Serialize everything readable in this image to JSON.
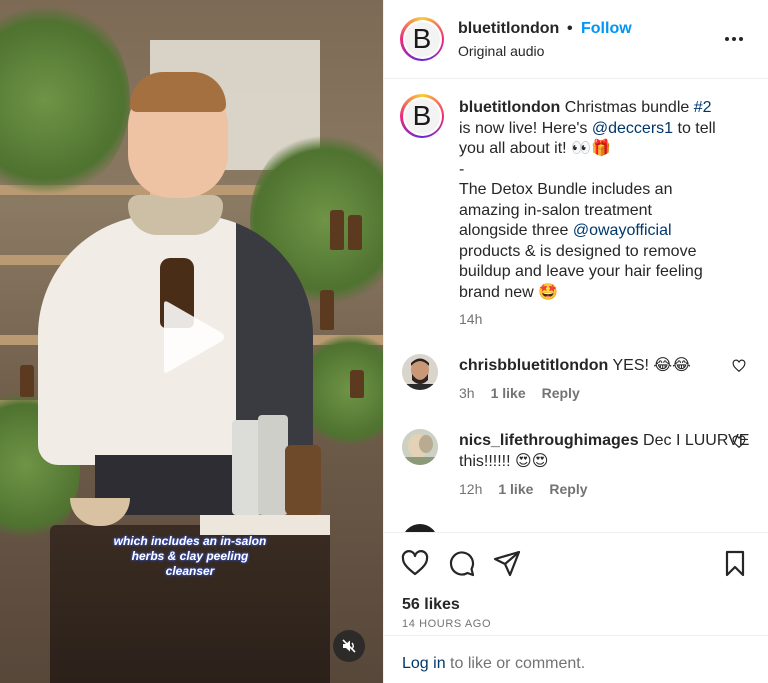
{
  "video": {
    "caption_lines": [
      "which includes an in-salon",
      "herbs & clay peeling",
      "cleanser"
    ]
  },
  "header": {
    "avatar_letter": "B",
    "username": "bluetitlondon",
    "separator": "•",
    "follow_label": "Follow",
    "audio": "Original audio"
  },
  "post": {
    "avatar_letter": "B",
    "username": "bluetitlondon",
    "lines": [
      [
        "Christmas bundle ",
        "#2"
      ],
      [
        "is now live! Here's ",
        "@deccers1",
        " to tell"
      ],
      [
        "you all about it! 👀🎁"
      ],
      [
        "-"
      ],
      [
        "The Detox Bundle includes an"
      ],
      [
        "amazing in-salon treatment"
      ],
      [
        "alongside three ",
        "@owayofficial"
      ],
      [
        "products & is designed to remove"
      ],
      [
        "buildup and leave your hair feeling"
      ],
      [
        "brand new 🤩"
      ]
    ],
    "time": "14h"
  },
  "comments": [
    {
      "username": "chrisbbluetitlondon",
      "text": "YES! 😂😂",
      "time": "3h",
      "likes": "1 like",
      "reply": "Reply"
    },
    {
      "username": "nics_lifethroughimages",
      "text_line1": "Dec I LUURVE",
      "text_line2": "this!!!!!! 😍😍",
      "time": "12h",
      "likes": "1 like",
      "reply": "Reply"
    }
  ],
  "footer": {
    "likes": "56 likes",
    "ago": "14 HOURS AGO",
    "login_link": "Log in",
    "login_rest": " to like or comment."
  },
  "icons": {
    "play": "play-icon",
    "mute": "muted-speaker-icon",
    "more": "more-options-icon",
    "like": "heart-icon",
    "comment": "comment-bubble-icon",
    "share": "paper-plane-icon",
    "save": "bookmark-icon"
  },
  "colors": {
    "follow": "#0095f6",
    "hashtag": "#00376b",
    "muted_text": "#737373"
  }
}
